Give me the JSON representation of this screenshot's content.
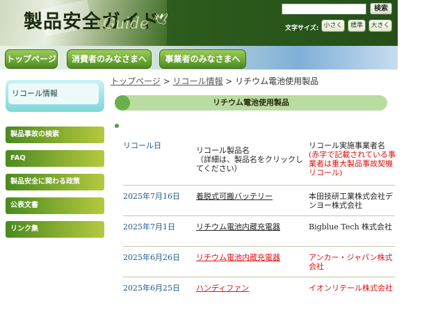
{
  "header": {
    "logo_text": "製品安全ガイド",
    "logo_sub": "Guide",
    "search_button": "検索",
    "text_size_label": "文字サイズ:",
    "size_small": "小さく",
    "size_standard": "標準",
    "size_large": "大きく"
  },
  "nav": {
    "top": "トップページ",
    "consumer": "消費者のみなさまへ",
    "business": "事業者のみなさまへ"
  },
  "sidebar": {
    "current": "リコール情報",
    "items": [
      {
        "label": "製品事故の検索"
      },
      {
        "label": "FAQ"
      },
      {
        "label": "製品安全に関わる政策"
      },
      {
        "label": "公表文書"
      },
      {
        "label": "リンク集"
      }
    ]
  },
  "breadcrumb": {
    "home": "トップページ",
    "sep1": " > ",
    "recall": "リコール情報",
    "sep2": " > ",
    "current": "リチウム電池使用製品"
  },
  "page_title": "リチウム電池使用製品",
  "table": {
    "headers": {
      "date": "リコール日",
      "product_line1": "リコール製品名",
      "product_line2": "（詳細は、製品名をクリックしてください）",
      "vendor_line1": "リコール実施事業者名",
      "vendor_red": "(赤字で記載されている事業者は重大製品事故契機リコール)"
    },
    "rows": [
      {
        "date": "2025年7月16日",
        "product": "着脱式可搬バッテリー",
        "vendor": "本田技研工業株式会社デンヨー株式会社"
      },
      {
        "date": "2025年7月1日",
        "product": "リチウム電池内蔵充電器",
        "vendor": "Bigblue Tech 株式会社"
      },
      {
        "date": "2025年6月26日",
        "product": "リチウム電池内蔵充電器",
        "vendor": "アンカー・ジャパン株式会社"
      },
      {
        "date": "2025年6月25日",
        "product": "ハンディファン",
        "vendor": "イオンリテール株式会社"
      }
    ]
  }
}
